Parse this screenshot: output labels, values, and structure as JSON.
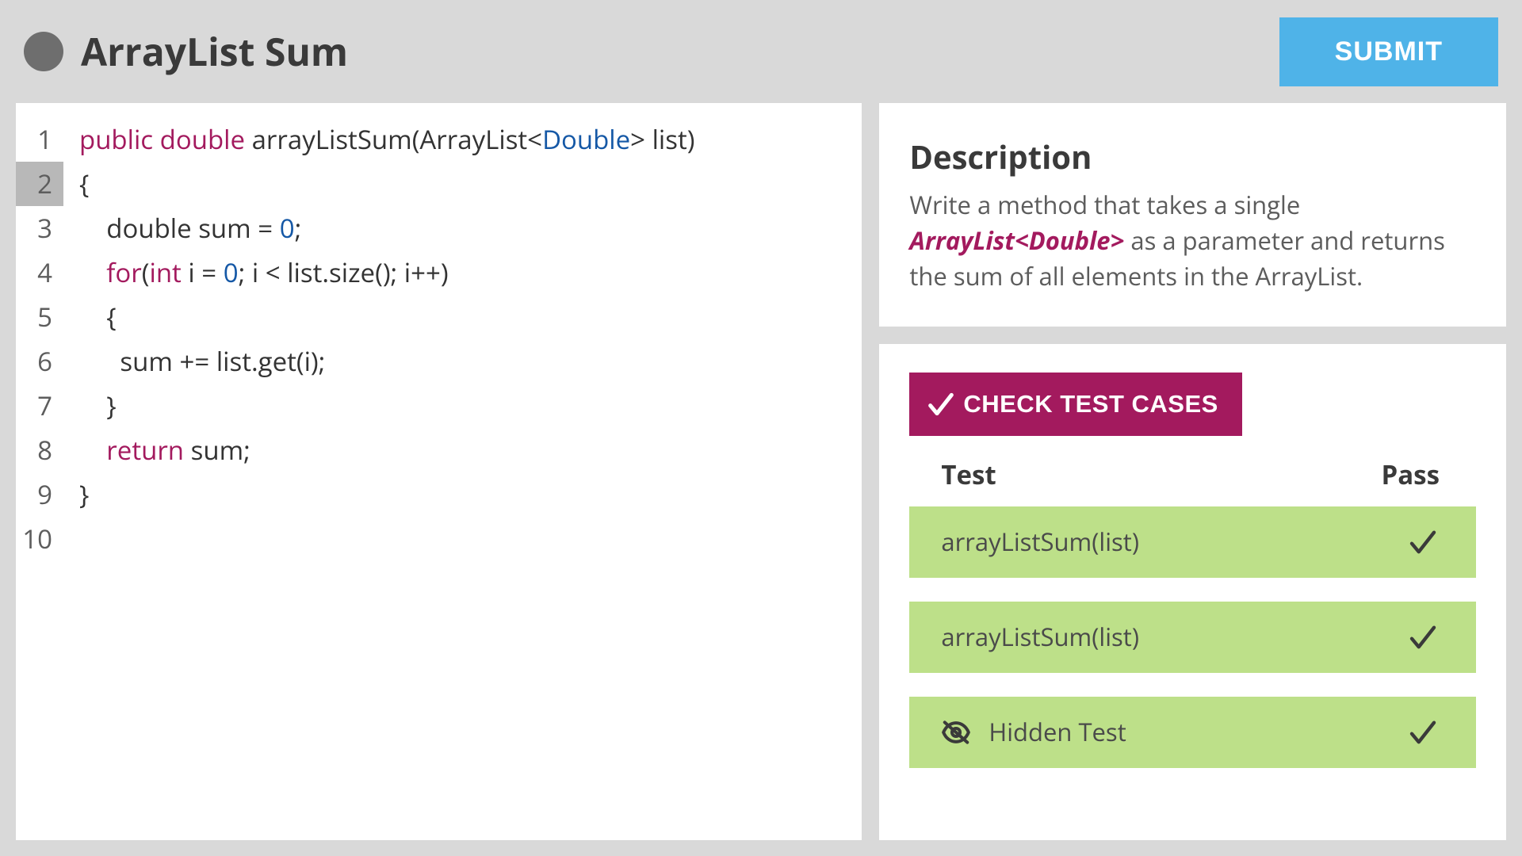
{
  "header": {
    "title": "ArrayList Sum",
    "submit_label": "SUBMIT"
  },
  "editor": {
    "active_line": 2,
    "line_count": 10,
    "code": {
      "l1": {
        "kw1": "public",
        "kw2": "double",
        "rest1": " arrayListSum(ArrayList<",
        "type": "Double",
        "rest2": "> list)"
      },
      "l2": "{",
      "l3": {
        "pre": "    double sum = ",
        "num": "0",
        "post": ";"
      },
      "l4": {
        "kw1": "for",
        "p1": "(",
        "kw2": "int",
        "p2": " i = ",
        "num": "0",
        "p3": "; i < list.size(); i++)"
      },
      "l5": "    {",
      "l6": "      sum += list.get(i);",
      "l7": "    }",
      "l8": {
        "kw": "return",
        "rest": " sum;"
      },
      "l9": "}",
      "l10": ""
    }
  },
  "description": {
    "heading": "Description",
    "body_pre": "Write a method that takes a single ",
    "body_em": "ArrayList<Double>",
    "body_post": " as a parameter and returns the sum of all elements in the ArrayList."
  },
  "tests": {
    "check_label": "CHECK TEST CASES",
    "col_test": "Test",
    "col_pass": "Pass",
    "rows": [
      {
        "label": "arrayListSum(list)",
        "hidden": false,
        "pass": true
      },
      {
        "label": "arrayListSum(list)",
        "hidden": false,
        "pass": true
      },
      {
        "label": "Hidden Test",
        "hidden": true,
        "pass": true
      }
    ]
  },
  "colors": {
    "accent": "#4fb3e8",
    "keyword": "#a31a5e",
    "pass_bg": "#bde089"
  }
}
